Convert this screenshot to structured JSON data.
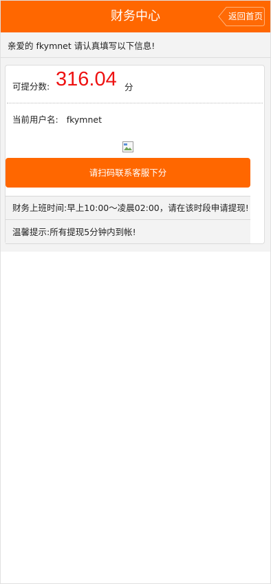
{
  "header": {
    "title": "财务中心",
    "back_label": "返回首页"
  },
  "greeting": "亲爱的 fkymnet 请认真填写以下信息!",
  "points": {
    "label": "可提分数:",
    "value": "316.04",
    "unit": "分"
  },
  "user": {
    "label": "当前用户名:",
    "name": "fkymnet"
  },
  "scan_button_label": "请扫码联系客服下分",
  "notices": {
    "hours": "财务上班时间:早上10:00～凌晨02:00，请在该时段申请提现!",
    "tip": "温馨提示:所有提现5分钟内到帐!"
  },
  "colors": {
    "accent": "#ff6700",
    "points_value": "#ee1111"
  }
}
